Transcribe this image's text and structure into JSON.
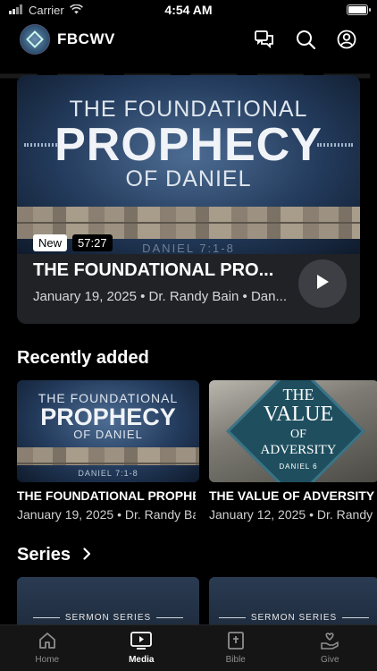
{
  "status_bar": {
    "carrier": "Carrier",
    "time": "4:54 AM"
  },
  "header": {
    "brand": "FBCWV"
  },
  "hero": {
    "art": {
      "line1": "THE FOUNDATIONAL",
      "big": "PROPHECY",
      "line3": "OF DANIEL",
      "scripture": "DANIEL 7:1-8"
    },
    "badge_new": "New",
    "duration": "57:27",
    "title": "THE FOUNDATIONAL PRO...",
    "meta": "January 19, 2025 • Dr. Randy Bain • Dan..."
  },
  "recently_added": {
    "heading": "Recently added",
    "items": [
      {
        "art": {
          "line1": "THE FOUNDATIONAL",
          "big": "PROPHECY",
          "line3": "OF DANIEL",
          "scripture": "DANIEL 7:1-8"
        },
        "title": "THE FOUNDATIONAL PROPHE",
        "meta": "January 19, 2025 • Dr. Randy Ba"
      },
      {
        "art": {
          "line1": "THE",
          "big": "VALUE",
          "line3": "OF",
          "line4": "ADVERSITY",
          "scripture": "DANIEL 6"
        },
        "title": "THE VALUE OF ADVERSITY",
        "meta": "January 12, 2025 • Dr. Randy"
      }
    ]
  },
  "series": {
    "heading": "Series",
    "items": [
      {
        "label": "SERMON SERIES"
      },
      {
        "label": "SERMON SERIES"
      }
    ]
  },
  "tabs": [
    {
      "label": "Home",
      "icon": "home-icon",
      "active": false
    },
    {
      "label": "Media",
      "icon": "media-icon",
      "active": true
    },
    {
      "label": "Bible",
      "icon": "bible-icon",
      "active": false
    },
    {
      "label": "Give",
      "icon": "give-icon",
      "active": false
    }
  ],
  "colors": {
    "background": "#000000",
    "card": "#202226",
    "accent_art": "#233b5c"
  }
}
